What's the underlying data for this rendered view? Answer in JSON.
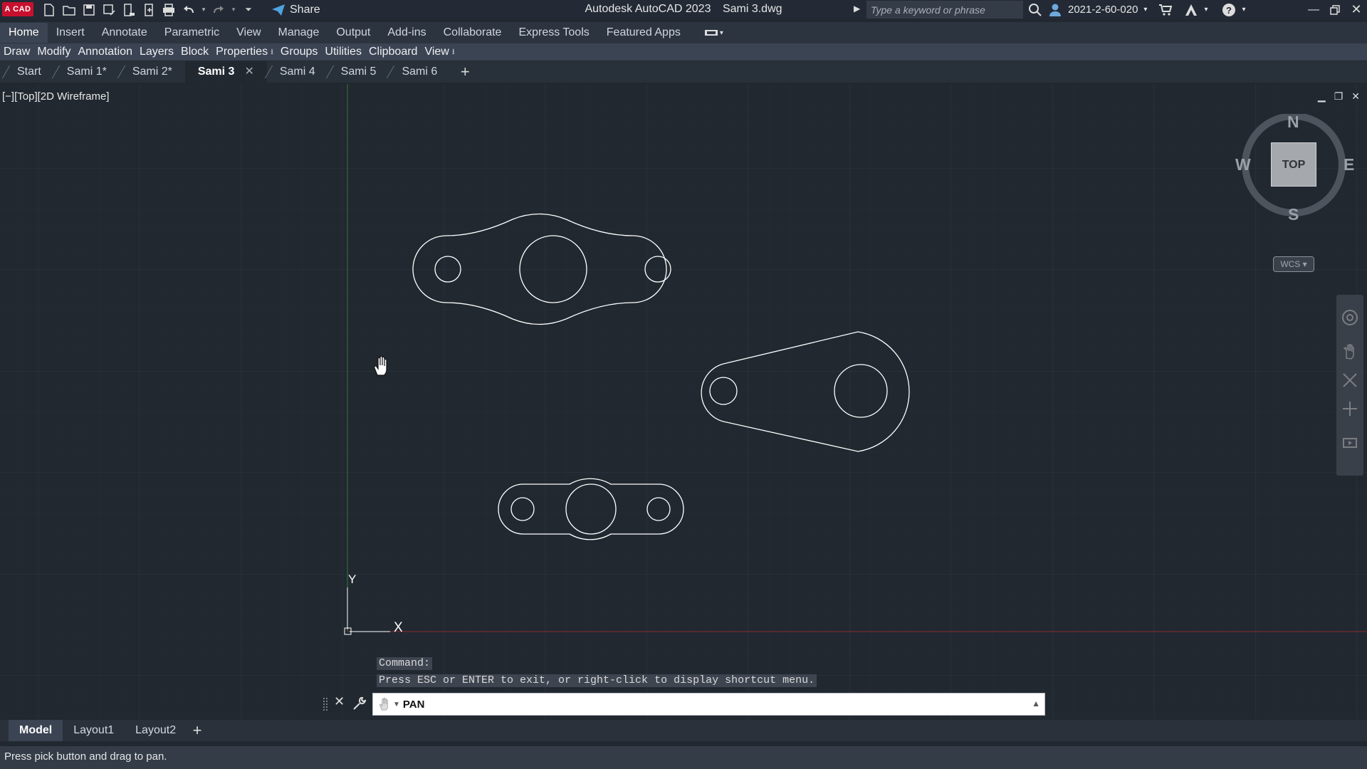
{
  "titlebar": {
    "logo_text": "A CAD",
    "share_label": "Share",
    "app_name": "Autodesk AutoCAD 2023",
    "file_name": "Sami 3.dwg",
    "search_placeholder": "Type a keyword or phrase",
    "user_id": "2021-2-60-020",
    "icons": [
      "new-icon",
      "open-icon",
      "save-icon",
      "save-as-icon",
      "publish-icon",
      "plot-preview-icon",
      "print-icon",
      "undo-icon",
      "redo-icon",
      "customize-icon"
    ]
  },
  "ribbon": {
    "tabs": [
      "Home",
      "Insert",
      "Annotate",
      "Parametric",
      "View",
      "Manage",
      "Output",
      "Add-ins",
      "Collaborate",
      "Express Tools",
      "Featured Apps"
    ],
    "active_tab": "Home",
    "panels": [
      {
        "label": "Draw",
        "expand": false
      },
      {
        "label": "Modify",
        "expand": false
      },
      {
        "label": "Annotation",
        "expand": false
      },
      {
        "label": "Layers",
        "expand": false
      },
      {
        "label": "Block",
        "expand": false
      },
      {
        "label": "Properties",
        "expand": true
      },
      {
        "label": "Groups",
        "expand": false
      },
      {
        "label": "Utilities",
        "expand": false
      },
      {
        "label": "Clipboard",
        "expand": false
      },
      {
        "label": "View",
        "expand": true
      }
    ]
  },
  "doc_tabs": {
    "tabs": [
      {
        "label": "Start",
        "active": false
      },
      {
        "label": "Sami 1*",
        "active": false
      },
      {
        "label": "Sami 2*",
        "active": false
      },
      {
        "label": "Sami 3",
        "active": true
      },
      {
        "label": "Sami 4",
        "active": false
      },
      {
        "label": "Sami 5",
        "active": false
      },
      {
        "label": "Sami 6",
        "active": false
      }
    ],
    "add_label": "+",
    "close_glyph": "✕"
  },
  "viewport": {
    "label": "[−][Top][2D Wireframe]",
    "viewcube": {
      "north": "N",
      "south": "S",
      "east": "E",
      "west": "W",
      "face": "TOP"
    },
    "wcs_label": "WCS",
    "ucs": {
      "x_label": "X",
      "y_label": "Y"
    }
  },
  "command": {
    "history": [
      "Command:",
      "Press ESC or ENTER to exit, or right-click to display shortcut menu."
    ],
    "current": "PAN"
  },
  "layout_tabs": {
    "tabs": [
      {
        "label": "Model",
        "active": true
      },
      {
        "label": "Layout1",
        "active": false
      },
      {
        "label": "Layout2",
        "active": false
      }
    ],
    "add_label": "+"
  },
  "status": {
    "message": "Press pick button and drag to pan."
  },
  "colors": {
    "background": "#212830",
    "geometry": "#ffffff",
    "grid": "#2b333d",
    "y_axis": "#2e7d32",
    "x_axis": "#8b2a2a",
    "logo": "#c8102e",
    "share_icon": "#4fa3e0"
  }
}
